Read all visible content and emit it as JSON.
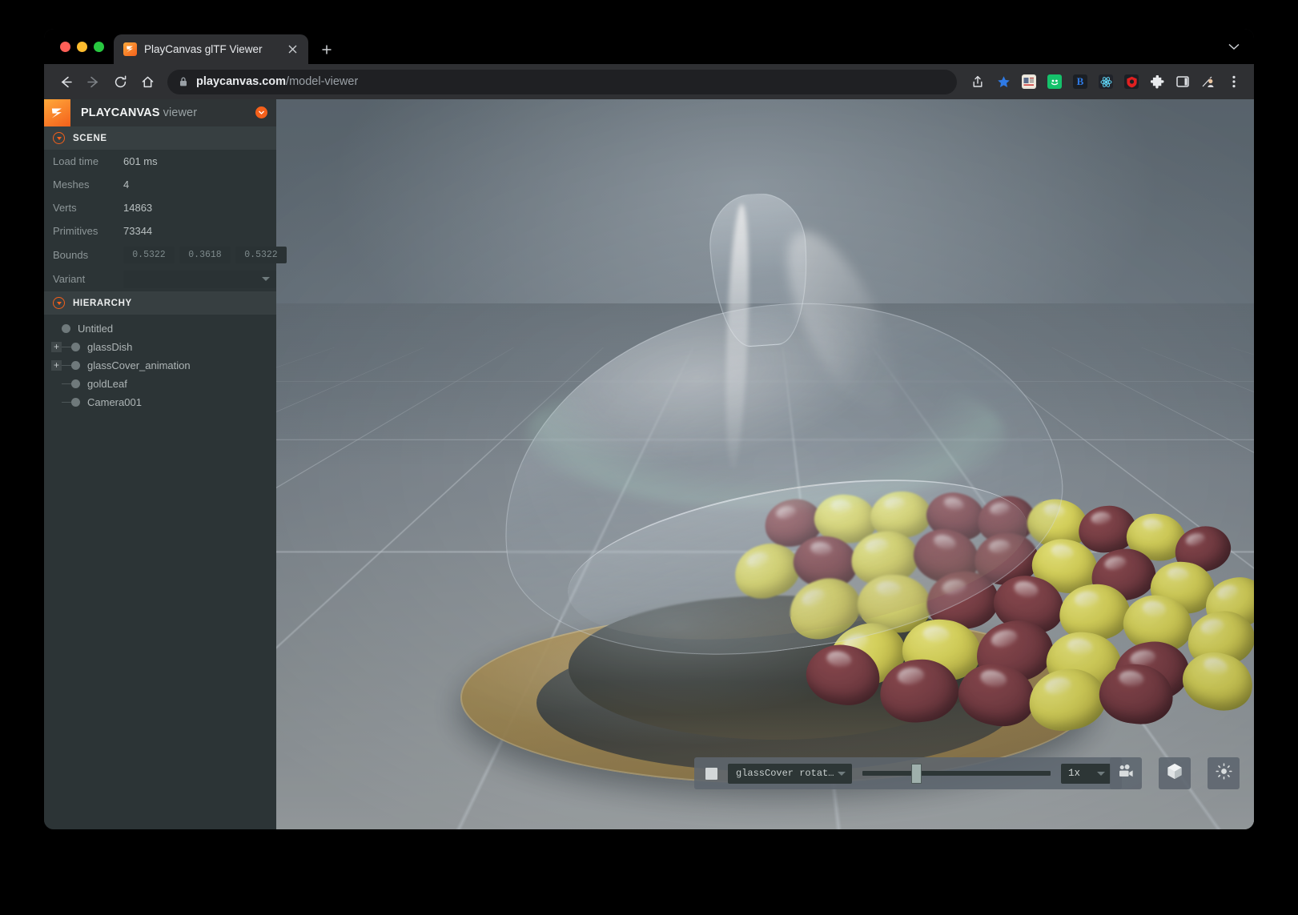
{
  "window": {
    "traffic_lights": [
      "close",
      "minimize",
      "maximize"
    ]
  },
  "browser": {
    "tab": {
      "title": "PlayCanvas glTF Viewer",
      "favicon": "playcanvas-logo-icon",
      "close_label": "×"
    },
    "new_tab_label": "+",
    "nav": {
      "back": "←",
      "forward": "→",
      "reload": "⟳",
      "home": "⌂"
    },
    "omnibox": {
      "lock": "lock-icon",
      "domain": "playcanvas.com",
      "path": "/model-viewer"
    },
    "toolbar_icons": [
      "share-icon",
      "bookmark-star-icon",
      "news-extension-icon",
      "grammarly-extension-icon",
      "bitwarden-extension-icon",
      "react-devtools-extension-icon",
      "ublock-extension-icon",
      "puzzle-extensions-icon",
      "side-panel-icon",
      "profile-avatar-icon",
      "more-menu-icon"
    ]
  },
  "sidebar": {
    "brand": {
      "name": "PLAYCANVAS",
      "suffix": " viewer"
    },
    "close_button": "collapse-panel",
    "scene_panel": {
      "title": "SCENE",
      "stats": [
        {
          "label": "Load time",
          "value": "601 ms"
        },
        {
          "label": "Meshes",
          "value": "4"
        },
        {
          "label": "Verts",
          "value": "14863"
        },
        {
          "label": "Primitives",
          "value": "73344"
        }
      ],
      "bounds": {
        "label": "Bounds",
        "values": [
          "0.5322",
          "0.3618",
          "0.5322"
        ]
      },
      "variant": {
        "label": "Variant",
        "value": ""
      }
    },
    "hierarchy_panel": {
      "title": "HIERARCHY",
      "nodes": [
        {
          "label": "Untitled",
          "depth": 0,
          "expandable": false
        },
        {
          "label": "glassDish",
          "depth": 1,
          "expandable": true
        },
        {
          "label": "glassCover_animation",
          "depth": 1,
          "expandable": true
        },
        {
          "label": "goldLeaf",
          "depth": 1,
          "expandable": false
        },
        {
          "label": "Camera001",
          "depth": 1,
          "expandable": false
        }
      ]
    }
  },
  "viewport": {
    "scene_description": "3D render of a glass cloche lifting off a golden dish filled with yellow and dark-red olives, on a perspective grid",
    "animation_bar": {
      "stop_button": "stop-icon",
      "animation_select": {
        "value": "glassCover rotat…"
      },
      "timeline": {
        "position_percent": 26
      },
      "speed_select": {
        "value": "1x"
      }
    },
    "tool_buttons": [
      {
        "name": "camera-button",
        "icon": "camera-icon"
      },
      {
        "name": "wireframe-button",
        "icon": "cube-icon"
      },
      {
        "name": "lighting-button",
        "icon": "sun-icon"
      },
      {
        "name": "fullscreen-button",
        "icon": "fullscreen-icon"
      },
      {
        "name": "download-button",
        "icon": "import-tray-icon"
      }
    ]
  },
  "colors": {
    "brand_orange": "#f4601b",
    "panel_bg": "#2c3436",
    "panel_header_bg": "#373f41",
    "field_bg": "#2a3234",
    "label_text": "#8d9698",
    "value_text": "#b9c0c1",
    "olive_yellow": "#e3dd58",
    "olive_red": "#7c3a40",
    "dish_gold": "#a98c4e"
  }
}
